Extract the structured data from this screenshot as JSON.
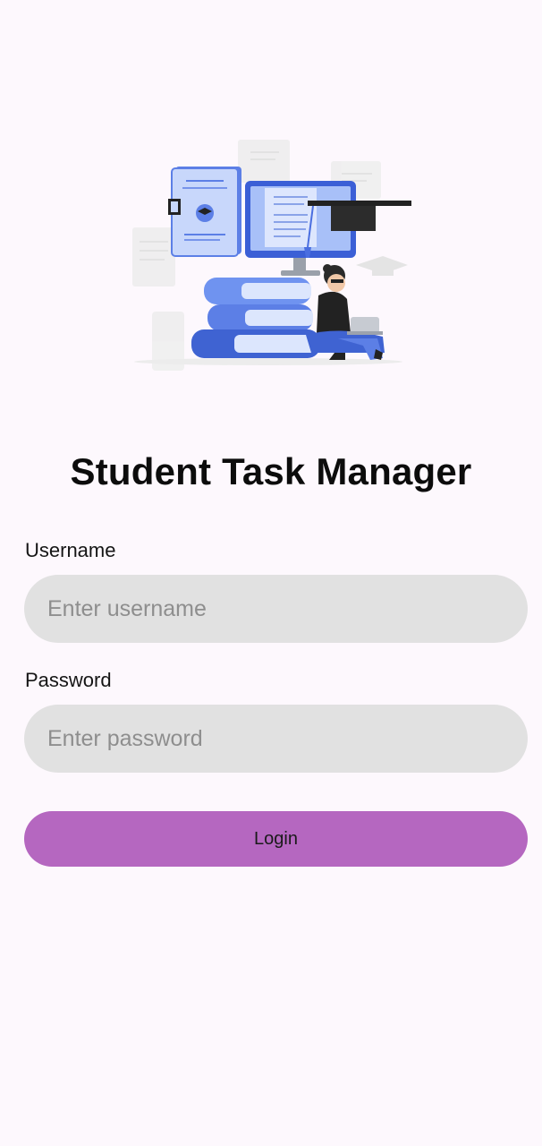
{
  "app": {
    "title": "Student Task Manager"
  },
  "form": {
    "username_label": "Username",
    "username_placeholder": "Enter username",
    "username_value": "",
    "password_label": "Password",
    "password_placeholder": "Enter password",
    "password_value": "",
    "login_label": "Login"
  },
  "colors": {
    "background": "#fdf8fd",
    "field_bg": "#e1e1e1",
    "login_button": "#b567c0",
    "illustration_blue": "#5c7fe6",
    "illustration_light_blue": "#a8c0f8"
  },
  "icons": {
    "hero": "student-studying-illustration"
  }
}
